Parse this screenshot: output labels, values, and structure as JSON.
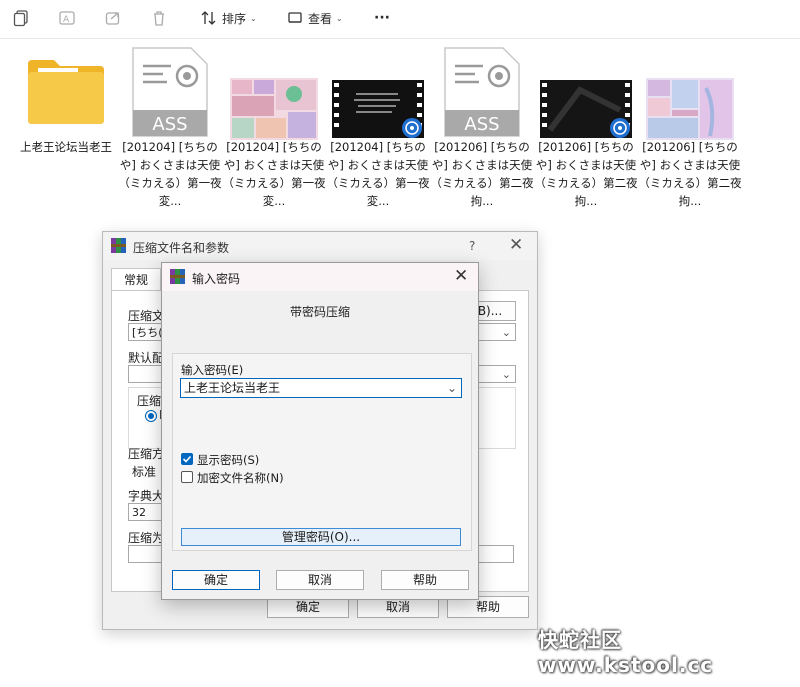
{
  "toolbar": {
    "sort_label": "排序",
    "view_label": "查看",
    "more_label": "···"
  },
  "files": [
    {
      "name": "上老王论坛当老王",
      "kind": "folder",
      "icon": "folder-icon"
    },
    {
      "name": "[201204] [ちちのや] おくさまは天使（ミカえる）第一夜 変...",
      "kind": "ass",
      "icon": "subtitle-file-icon"
    },
    {
      "name": "[201204] [ちちのや] おくさまは天使（ミカえる）第一夜 変...",
      "kind": "image",
      "icon": "image-thumbnail"
    },
    {
      "name": "[201204] [ちちのや] おくさまは天使（ミカえる）第一夜 変...",
      "kind": "video",
      "icon": "video-thumbnail"
    },
    {
      "name": "[201206] [ちちのや] おくさまは天使（ミカえる）第二夜 拘...",
      "kind": "ass",
      "icon": "subtitle-file-icon"
    },
    {
      "name": "[201206] [ちちのや] おくさまは天使（ミカえる）第二夜 拘...",
      "kind": "video",
      "icon": "video-thumbnail"
    },
    {
      "name": "[201206] [ちちのや] おくさまは天使（ミカえる）第二夜 拘...",
      "kind": "image",
      "icon": "image-thumbnail"
    }
  ],
  "ass_badge": "ASS",
  "back_dialog": {
    "title": "压缩文件名和参数",
    "help": "?",
    "tab_general": "常规",
    "label_archive_name": "压缩文",
    "archive_name_value": "[ちち(",
    "browse_button": "B)...",
    "label_default_profile": "默认配",
    "label_format": "压缩文",
    "format_option": "R",
    "label_method": "压缩方",
    "method_value": "标准",
    "label_dict": "字典大",
    "dict_value": "32",
    "label_split": "压缩为",
    "ok": "确定",
    "cancel": "取消",
    "help_button": "帮助"
  },
  "front_dialog": {
    "title": "输入密码",
    "heading": "带密码压缩",
    "password_label": "输入密码(E)",
    "password_value": "上老王论坛当老王",
    "show_password": "显示密码(S)",
    "show_password_checked": true,
    "encrypt_names": "加密文件名称(N)",
    "encrypt_names_checked": false,
    "manage_passwords": "管理密码(O)...",
    "ok": "确定",
    "cancel": "取消",
    "help": "帮助"
  },
  "watermark": "快蛇社区 www.kstool.cc",
  "colors": {
    "accent": "#0067c0",
    "folder": "#f7c948"
  }
}
